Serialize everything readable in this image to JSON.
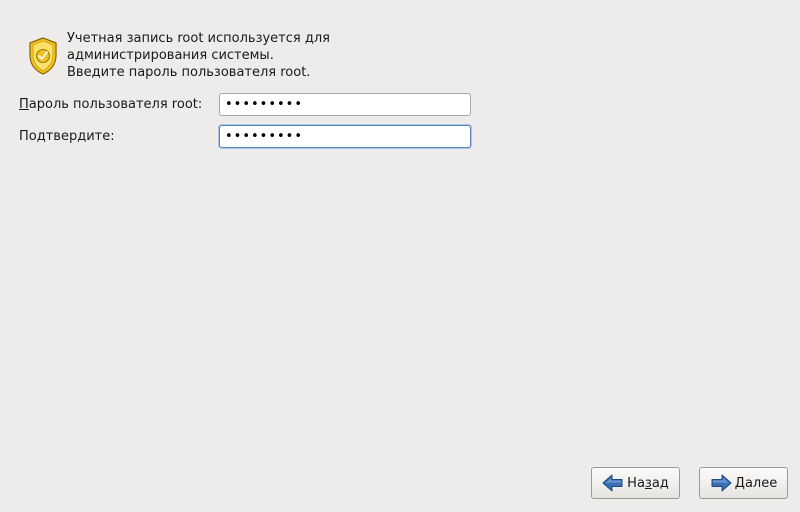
{
  "intro": {
    "icon": "security-badge-icon",
    "lines": [
      "Учетная запись root используется для",
      "администрирования системы.",
      "Введите пароль пользователя root."
    ]
  },
  "form": {
    "password_label_mnemonic": "П",
    "password_label_rest": "ароль пользователя root:",
    "password_value": "•••••••••",
    "confirm_label_pre": "Подтвер",
    "confirm_label_mnemonic": "д",
    "confirm_label_post": "ите:",
    "confirm_value": "•••••••••"
  },
  "buttons": {
    "back_pre": "На",
    "back_mnemonic": "з",
    "back_post": "ад",
    "back_icon": "arrow-left-icon",
    "next_mnemonic": "Д",
    "next_post": "алее",
    "next_icon": "arrow-right-icon"
  },
  "colors": {
    "background": "#edeceb",
    "arrow_blue": "#3c6eb4",
    "focus_border": "#5a87b8",
    "badge_gold": "#f2c01d"
  }
}
